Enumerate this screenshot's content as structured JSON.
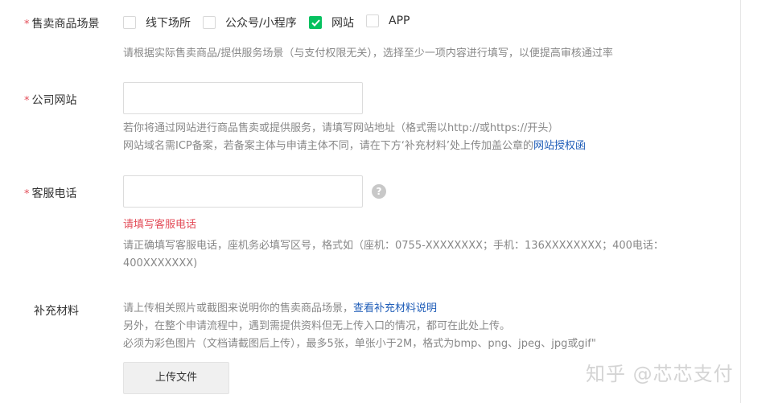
{
  "scene": {
    "label": "售卖商品场景",
    "options": [
      {
        "label": "线下场所",
        "checked": false
      },
      {
        "label": "公众号/小程序",
        "checked": false
      },
      {
        "label": "网站",
        "checked": true
      },
      {
        "label": "APP",
        "checked": false
      }
    ],
    "hint": "请根据实际售卖商品/提供服务场景（与支付权限无关），选择至少一项内容进行填写，以便提高审核通过率"
  },
  "website": {
    "label": "公司网站",
    "value": "",
    "hint_line1": "若你将通过网站进行商品售卖或提供服务，请填写网站地址（格式需以http://或https://开头）",
    "hint_line2_prefix": "网站域名需ICP备案，若备案主体与申请主体不同，请在下方‘补充材料’处上传加盖公章的",
    "hint_line2_link": "网站授权函"
  },
  "phone": {
    "label": "客服电话",
    "value": "",
    "help_icon": "?",
    "error": "请填写客服电话",
    "hint_line1": "请正确填写客服电话，座机务必填写区号，格式如（座机：0755-XXXXXXXX；手机：136XXXXXXXX；400电话：",
    "hint_line2": "400XXXXXXX)"
  },
  "materials": {
    "label": "补充材料",
    "hint_line1_prefix": "请上传相关照片或截图来说明你的售卖商品场景，",
    "hint_line1_link": "查看补充材料说明",
    "hint_line2": "另外，在整个申请流程中，遇到需提供资料但无上传入口的情况，都可在此处上传。",
    "hint_line3": "必须为彩色图片（文档请截图后上传），最多5张，单张小于2M，格式为bmp、png、jpeg、jpg或gif\"",
    "upload_label": "上传文件"
  },
  "required_mark": "*",
  "watermark": "知乎 @芯芯支付",
  "colors": {
    "accent": "#07c160",
    "error": "#e34d59",
    "link": "#1f5db8"
  }
}
